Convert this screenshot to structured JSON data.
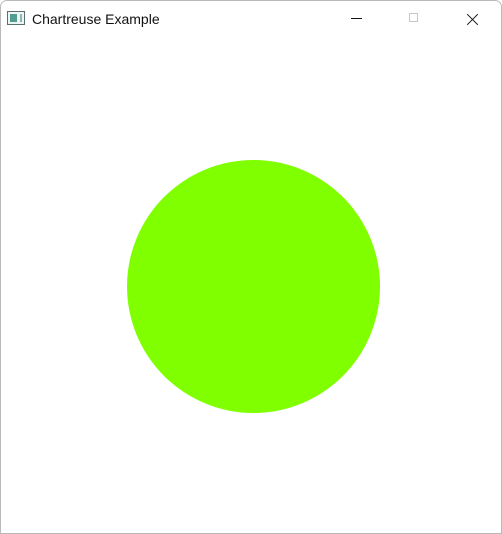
{
  "window": {
    "title": "Chartreuse Example"
  },
  "titlebar": {
    "app_icon": "window-app-icon",
    "controls": {
      "minimize": "minimize-icon",
      "maximize": "maximize-icon",
      "close": "close-icon"
    }
  },
  "canvas": {
    "shape": "circle",
    "fill_color": "#7fff00"
  }
}
